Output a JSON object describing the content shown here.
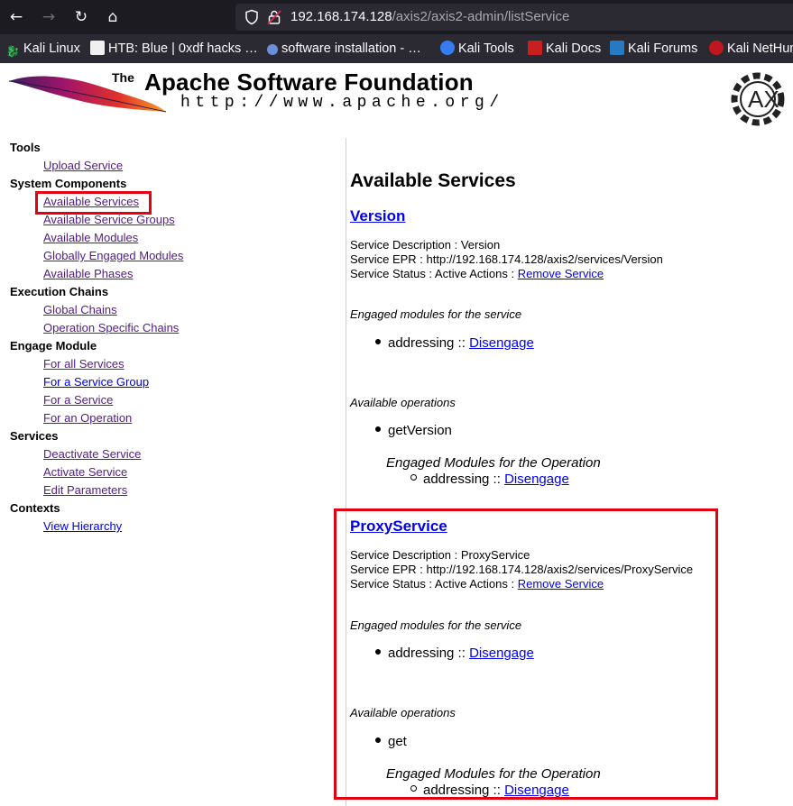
{
  "browser": {
    "nav": {
      "back": "←",
      "forward": "→",
      "reload": "↻",
      "home": "⌂"
    },
    "url_host": "192.168.174.128",
    "url_path": "/axis2/axis2-admin/listService"
  },
  "bookmarks": [
    {
      "label": "Kali Linux",
      "icon": "kali-dragon-icon"
    },
    {
      "label": "HTB: Blue | 0xdf hacks …",
      "icon": "0xdf-site-icon"
    },
    {
      "label": "software installation - …",
      "icon": "askubuntu-icon"
    },
    {
      "label": "Kali Tools",
      "icon": "kali-tools-icon"
    },
    {
      "label": "Kali Docs",
      "icon": "kali-docs-icon"
    },
    {
      "label": "Kali Forums",
      "icon": "kali-forums-icon"
    },
    {
      "label": "Kali NetHun",
      "icon": "kali-nethunter-icon"
    }
  ],
  "header": {
    "the": "The",
    "title": "Apache Software Foundation",
    "url": "http://www.apache.org/"
  },
  "leftnav": {
    "tools": {
      "heading": "Tools",
      "items": [
        "Upload Service"
      ]
    },
    "system": {
      "heading": "System Components",
      "items": [
        "Available Services",
        "Available Service Groups",
        "Available Modules",
        "Globally Engaged Modules",
        "Available Phases"
      ]
    },
    "chains": {
      "heading": "Execution Chains",
      "items": [
        "Global Chains",
        "Operation Specific Chains"
      ]
    },
    "engage": {
      "heading": "Engage Module",
      "items": [
        "For all Services",
        "For a Service Group",
        "For a Service",
        "For an Operation"
      ]
    },
    "services": {
      "heading": "Services",
      "items": [
        "Deactivate Service",
        "Activate Service",
        "Edit Parameters"
      ]
    },
    "contexts": {
      "heading": "Contexts",
      "items": [
        "View Hierarchy"
      ]
    }
  },
  "main": {
    "title": "Available Services",
    "services": [
      {
        "name": "Version",
        "description": "Service Description : Version",
        "epr": "Service EPR : http://192.168.174.128/axis2/services/Version",
        "status_prefix": "Service Status : Active Actions : ",
        "remove_label": "Remove Service",
        "engaged_heading": "Engaged modules for the service",
        "module": "addressing",
        "separator": " :: ",
        "disengage": "Disengage",
        "ops_heading": "Available operations",
        "operation": "getVersion",
        "op_modules_heading": "Engaged Modules for the Operation",
        "op_module": "addressing",
        "op_disengage": "Disengage"
      },
      {
        "name": "ProxyService",
        "description": "Service Description : ProxyService",
        "epr": "Service EPR : http://192.168.174.128/axis2/services/ProxyService",
        "status_prefix": "Service Status : Active Actions : ",
        "remove_label": "Remove Service",
        "engaged_heading": "Engaged modules for the service",
        "module": "addressing",
        "separator": " :: ",
        "disengage": "Disengage",
        "ops_heading": "Available operations",
        "operation": "get",
        "op_modules_heading": "Engaged Modules for the Operation",
        "op_module": "addressing",
        "op_disengage": "Disengage"
      }
    ]
  },
  "colors": {
    "highlight": "#e3000f",
    "link": "#0000ee",
    "visited": "#551a8b",
    "chrome": "#1c1b22"
  }
}
